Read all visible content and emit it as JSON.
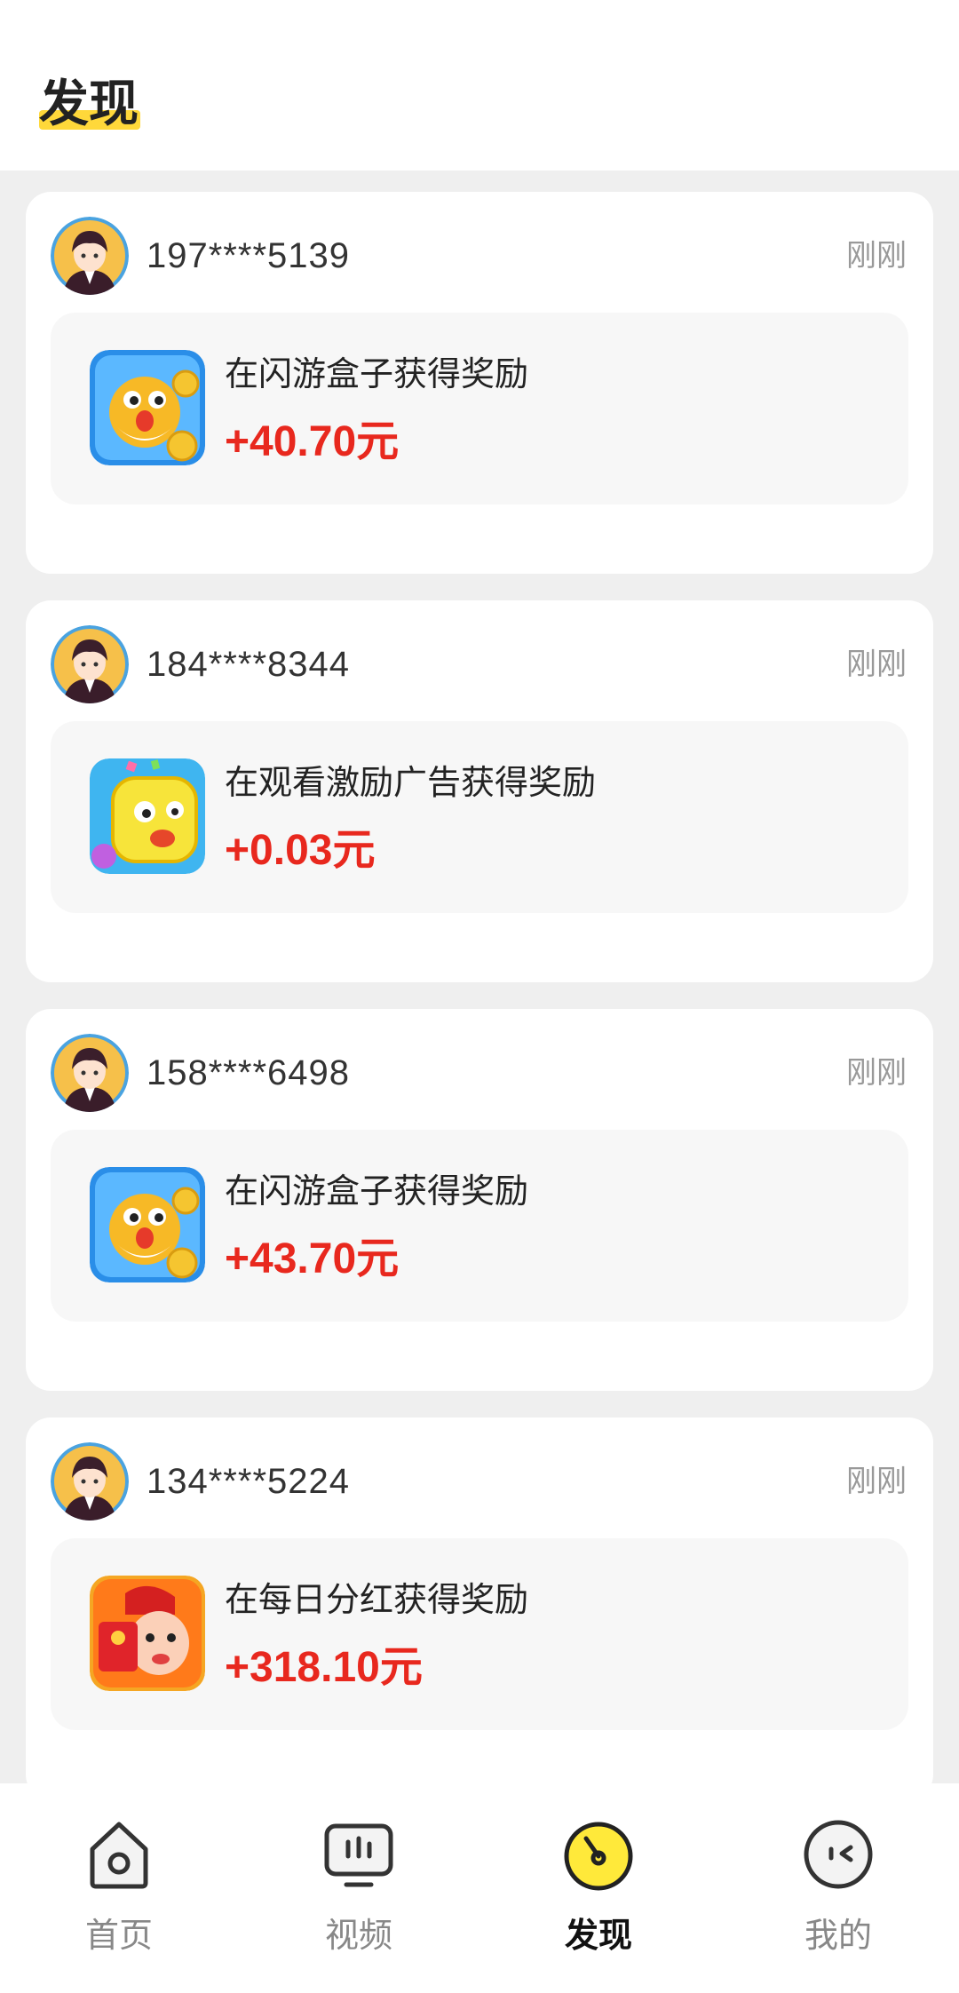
{
  "header": {
    "title": "发现"
  },
  "feed": [
    {
      "user": "197****5139",
      "time": "刚刚",
      "text": "在闪游盒子获得奖励",
      "amount": "+40.70元",
      "icon": "pufferfish-game-icon"
    },
    {
      "user": "184****8344",
      "time": "刚刚",
      "text": "在观看激励广告获得奖励",
      "amount": "+0.03元",
      "icon": "yellow-candy-game-icon"
    },
    {
      "user": "158****6498",
      "time": "刚刚",
      "text": "在闪游盒子获得奖励",
      "amount": "+43.70元",
      "icon": "pufferfish-game-icon"
    },
    {
      "user": "134****5224",
      "time": "刚刚",
      "text": "在每日分红获得奖励",
      "amount": "+318.10元",
      "icon": "red-envelope-game-icon"
    }
  ],
  "tabbar": {
    "tabs": [
      {
        "label": "首页",
        "icon": "home-icon"
      },
      {
        "label": "视频",
        "icon": "tv-icon"
      },
      {
        "label": "发现",
        "icon": "discover-icon"
      },
      {
        "label": "我的",
        "icon": "profile-face-icon"
      }
    ],
    "active_index": 2
  },
  "colors": {
    "accent": "#ffd83a",
    "amount": "#e8281e",
    "background": "#efefef"
  }
}
